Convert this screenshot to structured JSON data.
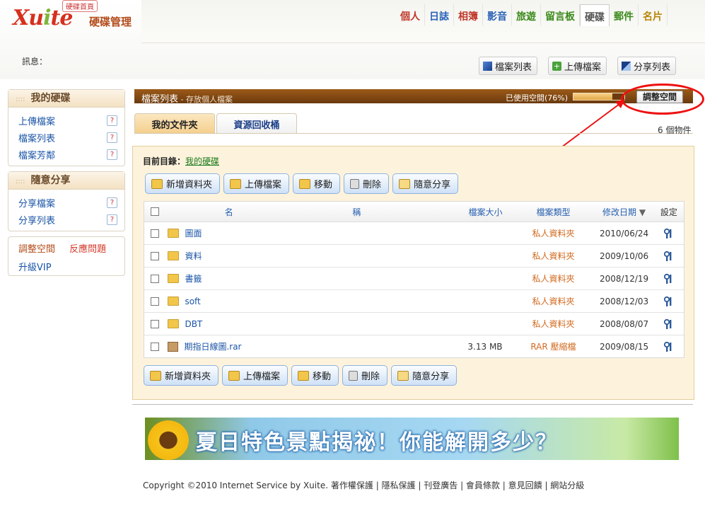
{
  "header": {
    "logo_text": "Xuite",
    "home_label": "硬碟首頁",
    "subtitle": "硬碟管理",
    "nav": [
      {
        "label": "個人",
        "color": "#c0392b"
      },
      {
        "label": "日誌",
        "color": "#2a62b8"
      },
      {
        "label": "相簿",
        "color": "#c0392b"
      },
      {
        "label": "影音",
        "color": "#2a62b8"
      },
      {
        "label": "旅遊",
        "color": "#3a8a1a"
      },
      {
        "label": "留言板",
        "color": "#3a8a1a"
      },
      {
        "label": "硬碟",
        "color": "#555555"
      },
      {
        "label": "郵件",
        "color": "#3a8a1a"
      },
      {
        "label": "名片",
        "color": "#b8860b"
      }
    ],
    "active_tab": "硬碟"
  },
  "message_label": "訊息：",
  "top_buttons": [
    "檔案列表",
    "上傳檔案",
    "分享列表"
  ],
  "sidebar": {
    "mydisk": {
      "title": "我的硬碟",
      "items": [
        "上傳檔案",
        "檔案列表",
        "檔案芳鄰"
      ]
    },
    "share": {
      "title": "隨意分享",
      "items": [
        "分享檔案",
        "分享列表"
      ]
    },
    "links": {
      "adjust": "調整空間",
      "report": "反應問題",
      "vip": "升級VIP"
    },
    "help": "?"
  },
  "titlebar": {
    "title": "檔案列表",
    "subtitle": " - 存放個人檔案",
    "usage_label": "已使用空間(76%)",
    "usage_fraction": 0.76,
    "adjust_button": "調整空間"
  },
  "tabs": [
    "我的文件夾",
    "資源回收桶"
  ],
  "object_count": "6 個物件",
  "current_dir": {
    "label": "目前目錄：",
    "path": "我的硬碟"
  },
  "actions": [
    "新增資料夾",
    "上傳檔案",
    "移動",
    "刪除",
    "隨意分享"
  ],
  "table": {
    "headers": {
      "name_a": "名",
      "name_b": "稱",
      "size": "檔案大小",
      "type": "檔案類型",
      "date": "修改日期",
      "sort": "▼",
      "settings": "設定"
    },
    "rows": [
      {
        "name": "圖面",
        "size": "",
        "type": "私人資料夾",
        "date": "2010/06/24",
        "icon": "folder"
      },
      {
        "name": "資料",
        "size": "",
        "type": "私人資料夾",
        "date": "2009/10/06",
        "icon": "folder"
      },
      {
        "name": "書籤",
        "size": "",
        "type": "私人資料夾",
        "date": "2008/12/19",
        "icon": "folder"
      },
      {
        "name": "soft",
        "size": "",
        "type": "私人資料夾",
        "date": "2008/12/03",
        "icon": "folder"
      },
      {
        "name": "DBT",
        "size": "",
        "type": "私人資料夾",
        "date": "2008/08/07",
        "icon": "folder"
      },
      {
        "name": "期指日線圖.rar",
        "size": "3.13 MB",
        "type": "RAR 壓縮檔",
        "date": "2009/08/15",
        "icon": "rar"
      }
    ]
  },
  "banner_text": "夏日特色景點揭祕！你能解開多少？",
  "footer": {
    "copyright": "Copyright ©2010 Internet Service by Xuite.",
    "links": [
      "著作權保護",
      "隱私保護",
      "刊登廣告",
      "會員條款",
      "意見回饋",
      "網站分級"
    ]
  },
  "colors": {
    "brown": "#8a4a12",
    "link": "#1a54a6",
    "type_orange": "#d2691e",
    "callout_red": "#e11111"
  }
}
